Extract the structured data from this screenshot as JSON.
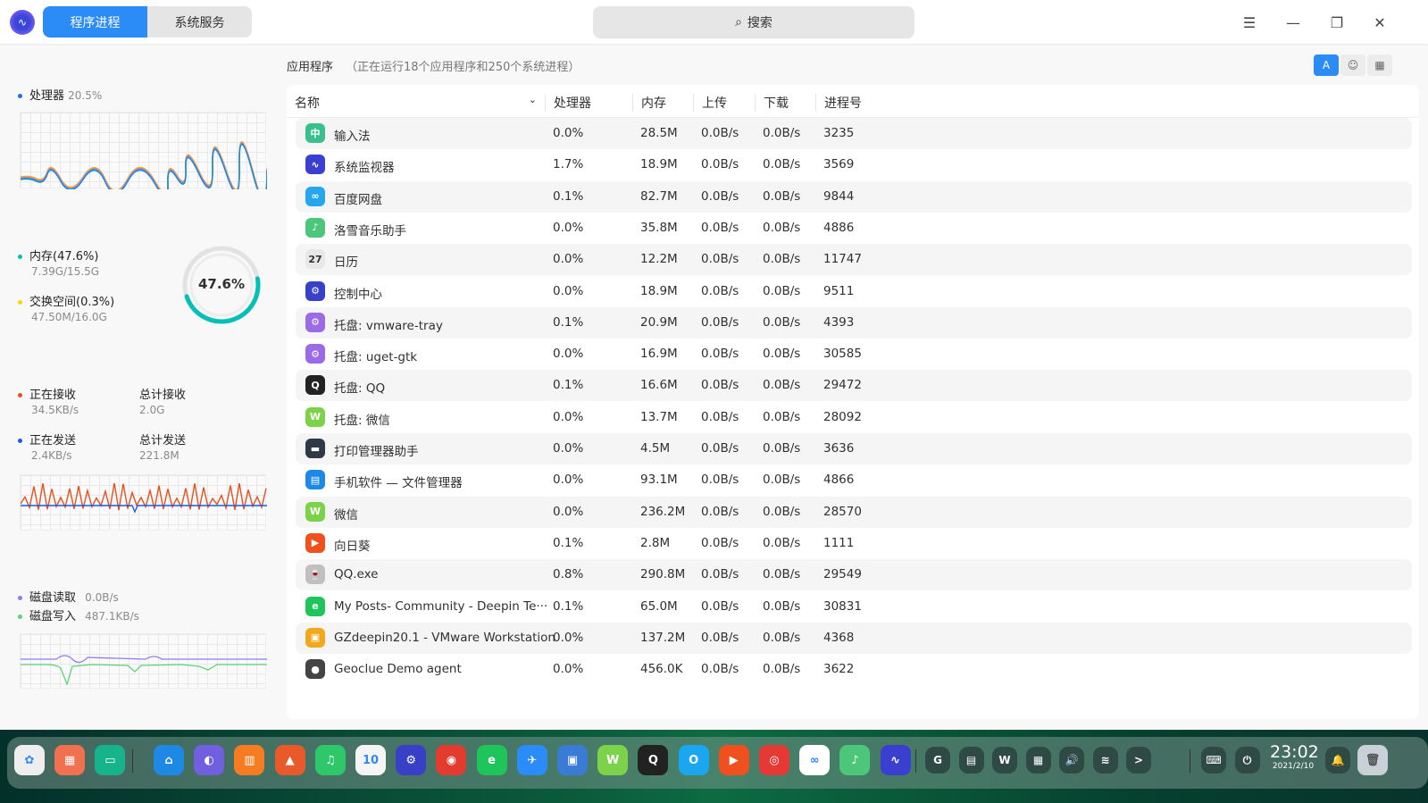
{
  "window": {
    "tabs": [
      "程序进程",
      "系统服务"
    ],
    "search_placeholder": "搜索",
    "menu_icon": "hamburger-icon"
  },
  "left": {
    "cpu": {
      "label": "处理器",
      "value": "20.5%"
    },
    "memory": {
      "label": "内存(47.6%)",
      "detail": "7.39G/15.5G",
      "ring_percent": "47.6%",
      "ring_fraction": 0.476
    },
    "swap": {
      "label": "交换空间(0.3%)",
      "detail": "47.50M/16.0G"
    },
    "net": {
      "recv_label": "正在接收",
      "recv": "34.5KB/s",
      "total_recv_label": "总计接收",
      "total_recv": "2.0G",
      "send_label": "正在发送",
      "send": "2.4KB/s",
      "total_send_label": "总计发送",
      "total_send": "221.8M"
    },
    "disk": {
      "read_label": "磁盘读取",
      "read": "0.0B/s",
      "write_label": "磁盘写入",
      "write": "487.1KB/s"
    },
    "colors": {
      "cpu": "#1a73e8",
      "mem": "#00c0b8",
      "swap": "#ffd400",
      "recv": "#e8501c",
      "send": "#1a5ae8",
      "read": "#8b7cf6",
      "write": "#5fd27a"
    }
  },
  "apps": {
    "title": "应用程序",
    "count": "（正在运行18个应用程序和250个系统进程）"
  },
  "table": {
    "headers": [
      "名称",
      "处理器",
      "内存",
      "上传",
      "下载",
      "进程号"
    ],
    "rows": [
      {
        "name": "输入法",
        "cpu": "0.0%",
        "mem": "28.5M",
        "up": "0.0B/s",
        "down": "0.0B/s",
        "pid": "3235",
        "color": "#3bbf8f",
        "glyph": "中"
      },
      {
        "name": "系统监视器",
        "cpu": "1.7%",
        "mem": "18.9M",
        "up": "0.0B/s",
        "down": "0.0B/s",
        "pid": "3569",
        "color": "#3a3fd0",
        "glyph": "∿"
      },
      {
        "name": "百度网盘",
        "cpu": "0.1%",
        "mem": "82.7M",
        "up": "0.0B/s",
        "down": "0.0B/s",
        "pid": "9844",
        "color": "#27a6f0",
        "glyph": "∞"
      },
      {
        "name": "洛雪音乐助手",
        "cpu": "0.0%",
        "mem": "35.8M",
        "up": "0.0B/s",
        "down": "0.0B/s",
        "pid": "4886",
        "color": "#4cc77a",
        "glyph": "♪"
      },
      {
        "name": "日历",
        "cpu": "0.0%",
        "mem": "12.2M",
        "up": "0.0B/s",
        "down": "0.0B/s",
        "pid": "11747",
        "color": "#e8e8e8",
        "glyph": "27"
      },
      {
        "name": "控制中心",
        "cpu": "0.0%",
        "mem": "18.9M",
        "up": "0.0B/s",
        "down": "0.0B/s",
        "pid": "9511",
        "color": "#3840c8",
        "glyph": "⚙"
      },
      {
        "name": "托盘: vmware-tray",
        "cpu": "0.1%",
        "mem": "20.9M",
        "up": "0.0B/s",
        "down": "0.0B/s",
        "pid": "4393",
        "color": "#9b6be6",
        "glyph": "⚙"
      },
      {
        "name": "托盘: uget-gtk",
        "cpu": "0.0%",
        "mem": "16.9M",
        "up": "0.0B/s",
        "down": "0.0B/s",
        "pid": "30585",
        "color": "#9b6be6",
        "glyph": "⚙"
      },
      {
        "name": "托盘: QQ",
        "cpu": "0.1%",
        "mem": "16.6M",
        "up": "0.0B/s",
        "down": "0.0B/s",
        "pid": "29472",
        "color": "#222222",
        "glyph": "Q"
      },
      {
        "name": "托盘: 微信",
        "cpu": "0.0%",
        "mem": "13.7M",
        "up": "0.0B/s",
        "down": "0.0B/s",
        "pid": "28092",
        "color": "#7cd34a",
        "glyph": "W"
      },
      {
        "name": "打印管理器助手",
        "cpu": "0.0%",
        "mem": "4.5M",
        "up": "0.0B/s",
        "down": "0.0B/s",
        "pid": "3636",
        "color": "#2e3a48",
        "glyph": "▬"
      },
      {
        "name": "手机软件 — 文件管理器",
        "cpu": "0.0%",
        "mem": "93.1M",
        "up": "0.0B/s",
        "down": "0.0B/s",
        "pid": "4866",
        "color": "#1e88e5",
        "glyph": "▤"
      },
      {
        "name": "微信",
        "cpu": "0.0%",
        "mem": "236.2M",
        "up": "0.0B/s",
        "down": "0.0B/s",
        "pid": "28570",
        "color": "#7cd34a",
        "glyph": "W"
      },
      {
        "name": "向日葵",
        "cpu": "0.1%",
        "mem": "2.8M",
        "up": "0.0B/s",
        "down": "0.0B/s",
        "pid": "1111",
        "color": "#f0501e",
        "glyph": "▶"
      },
      {
        "name": "QQ.exe",
        "cpu": "0.8%",
        "mem": "290.8M",
        "up": "0.0B/s",
        "down": "0.0B/s",
        "pid": "29549",
        "color": "#c0c0c0",
        "glyph": "🍷"
      },
      {
        "name": "My Posts- Community - Deepin Te···",
        "cpu": "0.1%",
        "mem": "65.0M",
        "up": "0.0B/s",
        "down": "0.0B/s",
        "pid": "30831",
        "color": "#1fc45a",
        "glyph": "e"
      },
      {
        "name": "GZdeepin20.1 - VMware Workstation",
        "cpu": "0.0%",
        "mem": "137.2M",
        "up": "0.0B/s",
        "down": "0.0B/s",
        "pid": "4368",
        "color": "#f2a81d",
        "glyph": "▣"
      },
      {
        "name": "Geoclue Demo agent",
        "cpu": "0.0%",
        "mem": "456.0K",
        "up": "0.0B/s",
        "down": "0.0B/s",
        "pid": "3622",
        "color": "#444444",
        "glyph": "●"
      }
    ]
  },
  "dock": {
    "apps": [
      {
        "name": "launcher",
        "color": "#eeeeee",
        "glyph": "✿"
      },
      {
        "name": "multitasking",
        "color": "#f07050",
        "glyph": "▦"
      },
      {
        "name": "desktop",
        "color": "#17b38a",
        "glyph": "▭"
      },
      {
        "name": "file-manager",
        "color": "#1e88e5",
        "glyph": "⌂"
      },
      {
        "name": "browser",
        "color": "#7060e0",
        "glyph": "◐"
      },
      {
        "name": "app-store",
        "color": "#f57c20",
        "glyph": "▥"
      },
      {
        "name": "image-viewer",
        "color": "#e85a2a",
        "glyph": "▲"
      },
      {
        "name": "music",
        "color": "#2ec86a",
        "glyph": "♫"
      },
      {
        "name": "calendar",
        "color": "#f5f5f5",
        "glyph": "10"
      },
      {
        "name": "control-center",
        "color": "#3840c8",
        "glyph": "⚙"
      },
      {
        "name": "chrome",
        "color": "#e33b2e",
        "glyph": "◉"
      },
      {
        "name": "edge",
        "color": "#1fc45a",
        "glyph": "e"
      },
      {
        "name": "thunder",
        "color": "#2b8bf7",
        "glyph": "✈"
      },
      {
        "name": "vmware",
        "color": "#3a7bd5",
        "glyph": "▣"
      },
      {
        "name": "wechat",
        "color": "#7cd34a",
        "glyph": "W"
      },
      {
        "name": "qq",
        "color": "#222222",
        "glyph": "Q"
      },
      {
        "name": "uget",
        "color": "#1aa7f0",
        "glyph": "O"
      },
      {
        "name": "sunlogin",
        "color": "#f0501e",
        "glyph": "▶"
      },
      {
        "name": "netease-music",
        "color": "#e53935",
        "glyph": "◎"
      },
      {
        "name": "baidu-netdisk",
        "color": "#ffffff",
        "glyph": "∞"
      },
      {
        "name": "lx-music",
        "color": "#4cc77a",
        "glyph": "♪"
      },
      {
        "name": "system-monitor",
        "color": "#3a3fd0",
        "glyph": "∿"
      }
    ],
    "tray": [
      "G",
      "▤",
      "W",
      "▦",
      "🔊",
      "wifi",
      ">",
      "⌨",
      "⏻"
    ],
    "time": "23:02",
    "date": "2021/2/10"
  }
}
